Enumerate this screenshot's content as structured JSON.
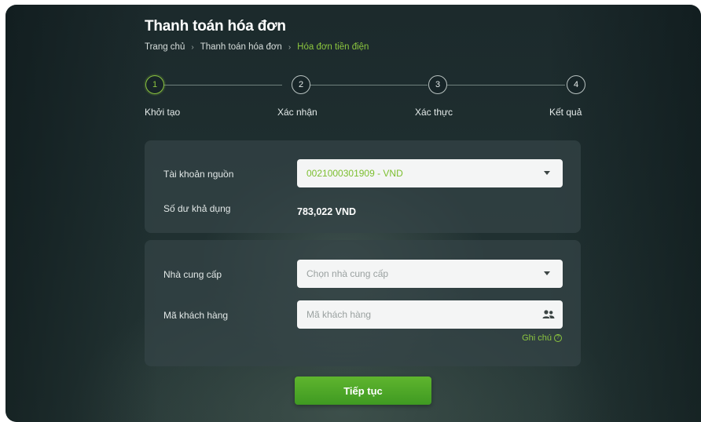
{
  "page": {
    "title": "Thanh toán hóa đơn"
  },
  "breadcrumb": {
    "items": [
      "Trang chủ",
      "Thanh toán hóa đơn",
      "Hóa đơn tiền điện"
    ],
    "separator": "›"
  },
  "stepper": {
    "steps": [
      {
        "number": "1",
        "label": "Khởi tạo",
        "active": true
      },
      {
        "number": "2",
        "label": "Xác nhận",
        "active": false
      },
      {
        "number": "3",
        "label": "Xác thực",
        "active": false
      },
      {
        "number": "4",
        "label": "Kết quả",
        "active": false
      }
    ]
  },
  "source_account": {
    "label": "Tài khoản nguồn",
    "selected": "0021000301909 - VND",
    "balance_label": "Số dư khả dụng",
    "balance_value": "783,022 VND"
  },
  "provider": {
    "label": "Nhà cung cấp",
    "placeholder": "Chọn nhà cung cấp"
  },
  "customer_code": {
    "label": "Mã khách hàng",
    "placeholder": "Mã khách hàng",
    "icon": "contacts-icon"
  },
  "note": {
    "label": "Ghi chú",
    "icon": "help-circle-icon"
  },
  "actions": {
    "continue_label": "Tiếp tục"
  },
  "colors": {
    "accent": "#8cc63f",
    "button": "#4ea828",
    "background": "#1f2f30"
  }
}
